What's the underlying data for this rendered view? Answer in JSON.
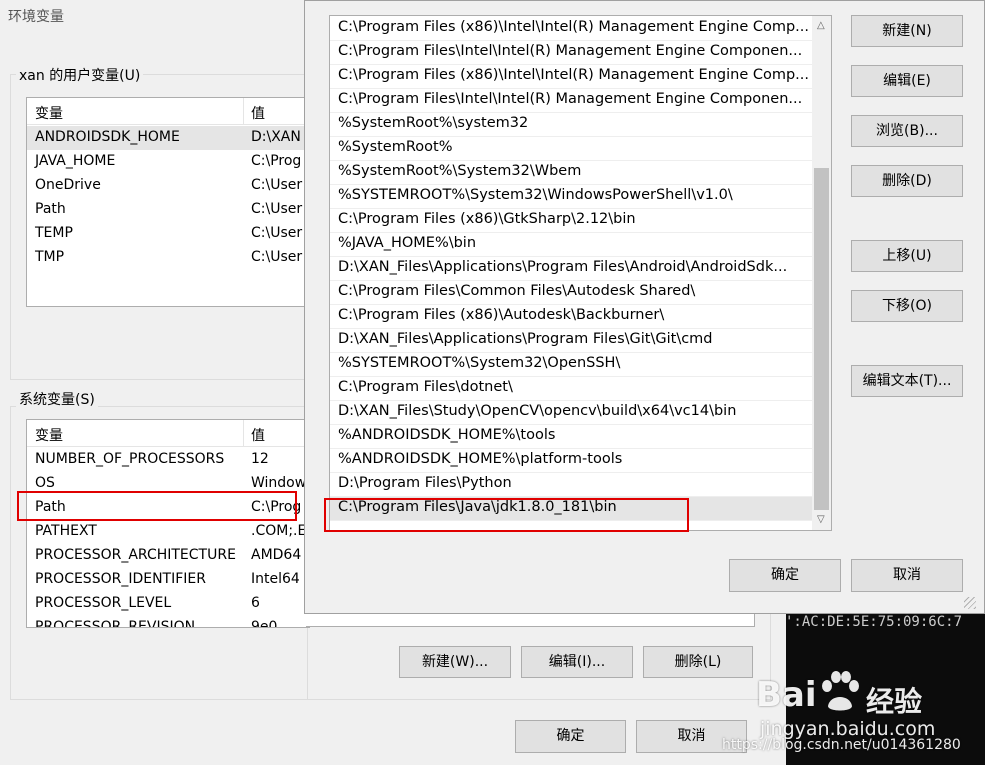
{
  "back_dialog": {
    "title": "环境变量",
    "user_group_label": "xan 的用户变量(U)",
    "user_headers": [
      "变量",
      "值"
    ],
    "user_vars": [
      {
        "name": "ANDROIDSDK_HOME",
        "value": "D:\\XAN"
      },
      {
        "name": "JAVA_HOME",
        "value": "C:\\Prog"
      },
      {
        "name": "OneDrive",
        "value": "C:\\User"
      },
      {
        "name": "Path",
        "value": "C:\\User"
      },
      {
        "name": "TEMP",
        "value": "C:\\User"
      },
      {
        "name": "TMP",
        "value": "C:\\User"
      }
    ],
    "system_group_label": "系统变量(S)",
    "system_headers": [
      "变量",
      "值"
    ],
    "system_vars": [
      {
        "name": "NUMBER_OF_PROCESSORS",
        "value": "12"
      },
      {
        "name": "OS",
        "value": "Window"
      },
      {
        "name": "Path",
        "value": "C:\\Prog"
      },
      {
        "name": "PATHEXT",
        "value": ".COM;.E"
      },
      {
        "name": "PROCESSOR_ARCHITECTURE",
        "value": "AMD64"
      },
      {
        "name": "PROCESSOR_IDENTIFIER",
        "value": "Intel64"
      },
      {
        "name": "PROCESSOR_LEVEL",
        "value": "6"
      },
      {
        "name": "PROCESSOR_REVISION",
        "value": "9e0"
      }
    ],
    "system_buttons": [
      "新建(W)...",
      "编辑(I)...",
      "删除(L)"
    ],
    "ok_label": "确定",
    "cancel_label": "取消"
  },
  "path_editor": {
    "entries": [
      "C:\\Program Files (x86)\\Intel\\Intel(R) Management Engine Comp...",
      "C:\\Program Files\\Intel\\Intel(R) Management Engine Componen...",
      "C:\\Program Files (x86)\\Intel\\Intel(R) Management Engine Comp...",
      "C:\\Program Files\\Intel\\Intel(R) Management Engine Componen...",
      "%SystemRoot%\\system32",
      "%SystemRoot%",
      "%SystemRoot%\\System32\\Wbem",
      "%SYSTEMROOT%\\System32\\WindowsPowerShell\\v1.0\\",
      "C:\\Program Files (x86)\\GtkSharp\\2.12\\bin",
      "%JAVA_HOME%\\bin",
      "D:\\XAN_Files\\Applications\\Program Files\\Android\\AndroidSdk...",
      "C:\\Program Files\\Common Files\\Autodesk Shared\\",
      "C:\\Program Files (x86)\\Autodesk\\Backburner\\",
      "D:\\XAN_Files\\Applications\\Program Files\\Git\\Git\\cmd",
      "%SYSTEMROOT%\\System32\\OpenSSH\\",
      "C:\\Program Files\\dotnet\\",
      "D:\\XAN_Files\\Study\\OpenCV\\opencv\\build\\x64\\vc14\\bin",
      "%ANDROIDSDK_HOME%\\tools",
      "%ANDROIDSDK_HOME%\\platform-tools",
      "D:\\Program Files\\Python",
      "C:\\Program Files\\Java\\jdk1.8.0_181\\bin"
    ],
    "selected_index": 20,
    "buttons": {
      "new": "新建(N)",
      "edit": "编辑(E)",
      "browse": "浏览(B)...",
      "delete": "删除(D)",
      "move_up": "上移(U)",
      "move_down": "下移(O)",
      "edit_text": "编辑文本(T)...",
      "ok": "确定",
      "cancel": "取消"
    }
  },
  "console": {
    "mac_text": "':AC:DE:5E:75:09:6C:7"
  },
  "watermark": {
    "brand": "Bai",
    "brand2": "经验",
    "site": "jingyan.baidu.com",
    "blog": "https://blog.csdn.net/u014361280"
  }
}
